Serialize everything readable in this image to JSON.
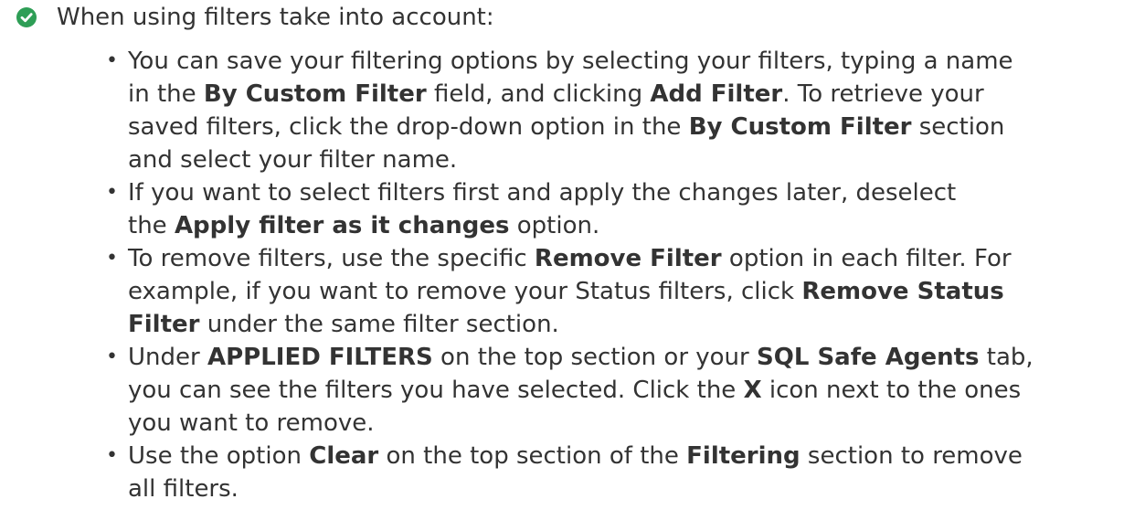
{
  "colors": {
    "check_icon": "#2e9e56",
    "text": "#333333"
  },
  "icon": "check-circle-icon",
  "heading": "When using filters take into account:",
  "tips": [
    {
      "lines": [
        [
          {
            "t": "You can save your filtering options by selecting your filters, typing a name"
          }
        ],
        [
          {
            "t": "in the "
          },
          {
            "t": "By Custom Filter",
            "b": true
          },
          {
            "t": " field, and clicking "
          },
          {
            "t": "Add Filter",
            "b": true
          },
          {
            "t": ". To retrieve your"
          }
        ],
        [
          {
            "t": "saved filters, click the drop-down option in the "
          },
          {
            "t": "By Custom Filter",
            "b": true
          },
          {
            "t": " section"
          }
        ],
        [
          {
            "t": "and select your filter name."
          }
        ]
      ]
    },
    {
      "lines": [
        [
          {
            "t": "If you want to select filters first and apply the changes later, deselect"
          }
        ],
        [
          {
            "t": "the "
          },
          {
            "t": "Apply filter as it changes",
            "b": true
          },
          {
            "t": " option."
          }
        ]
      ]
    },
    {
      "lines": [
        [
          {
            "t": "To remove filters, use the specific "
          },
          {
            "t": "Remove Filter",
            "b": true
          },
          {
            "t": " option in each filter. For"
          }
        ],
        [
          {
            "t": "example, if you want to remove your Status filters, click "
          },
          {
            "t": "Remove Status",
            "b": true
          }
        ],
        [
          {
            "t": "Filter",
            "b": true
          },
          {
            "t": " under the same filter section."
          }
        ]
      ]
    },
    {
      "lines": [
        [
          {
            "t": "Under "
          },
          {
            "t": "APPLIED FILTERS",
            "b": true
          },
          {
            "t": " on the top section or your "
          },
          {
            "t": "SQL Safe Agents",
            "b": true
          },
          {
            "t": " tab,"
          }
        ],
        [
          {
            "t": "you can see the filters you have selected. Click the "
          },
          {
            "t": "X",
            "b": true
          },
          {
            "t": " icon next to the ones"
          }
        ],
        [
          {
            "t": "you want to remove."
          }
        ]
      ]
    },
    {
      "lines": [
        [
          {
            "t": "Use the option "
          },
          {
            "t": "Clear",
            "b": true
          },
          {
            "t": " on the top section of the "
          },
          {
            "t": "Filtering",
            "b": true
          },
          {
            "t": " section to remove"
          }
        ],
        [
          {
            "t": "all filters."
          }
        ]
      ]
    }
  ]
}
